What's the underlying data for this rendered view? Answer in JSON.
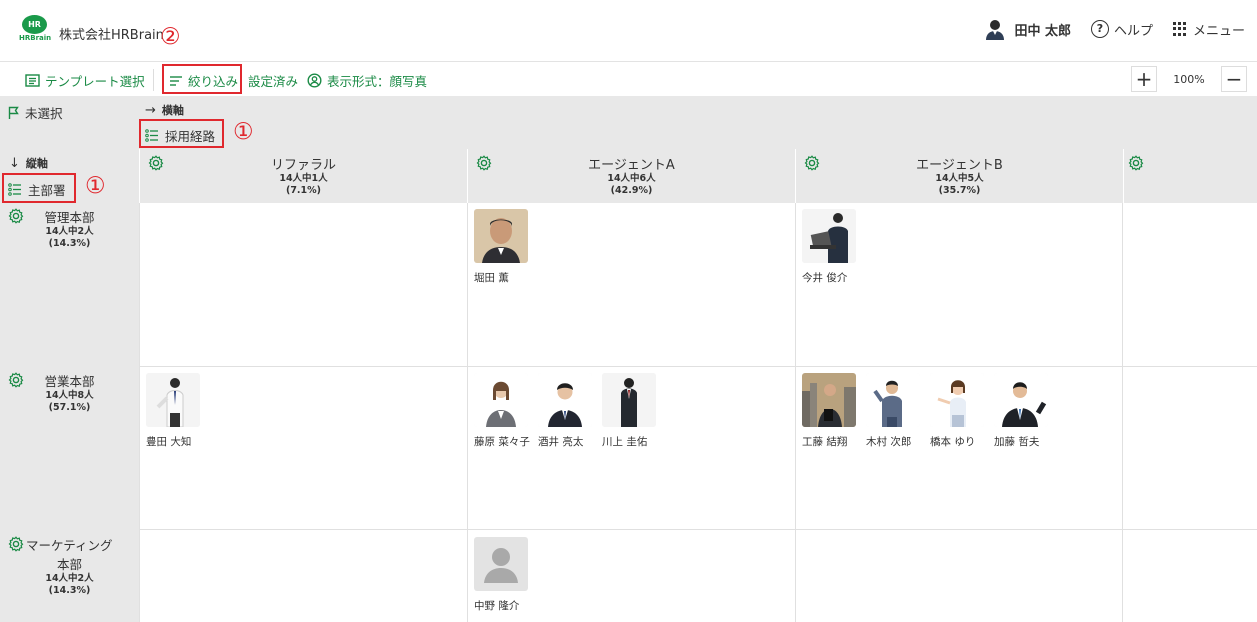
{
  "header": {
    "logo_text": "HR",
    "logo_sub": "HRBrain",
    "company": "株式会社HRBrain",
    "user_name": "田中 太郎",
    "help_label": "ヘルプ",
    "menu_label": "メニュー"
  },
  "toolbar": {
    "template_label": "テンプレート選択",
    "filter_label": "絞り込み",
    "filter_status": "設定済み",
    "display_label": "表示形式：顔写真",
    "zoom": "100%"
  },
  "annotations": {
    "one_a": "①",
    "one_b": "①",
    "two": "②"
  },
  "axes": {
    "unselected": "未選択",
    "horizontal_label": "横軸",
    "horizontal_value": "採用経路",
    "vertical_label": "縦軸",
    "vertical_value": "主部署"
  },
  "columns": [
    {
      "title": "リファラル",
      "count": "14人中1人",
      "pct": "(7.1%)"
    },
    {
      "title": "エージェントA",
      "count": "14人中6人",
      "pct": "(42.9%)"
    },
    {
      "title": "エージェントB",
      "count": "14人中5人",
      "pct": "(35.7%)"
    }
  ],
  "rows": [
    {
      "title": "管理本部",
      "count": "14人中2人",
      "pct": "(14.3%)"
    },
    {
      "title": "営業本部",
      "count": "14人中8人",
      "pct": "(57.1%)"
    },
    {
      "title": "マーケティング",
      "title2": "本部",
      "count": "14人中2人",
      "pct": "(14.3%)"
    }
  ],
  "people": {
    "hotta": "堀田 薫",
    "imai": "今井 俊介",
    "toyota": "豊田 大知",
    "fujiwara": "藤原 菜々子",
    "sakai": "酒井 亮太",
    "kawakami": "川上 圭佑",
    "kudo": "工藤 結翔",
    "kimura": "木村 次郎",
    "hashimoto": "橋本 ゆり",
    "kato": "加藤 哲夫",
    "nakano": "中野 隆介"
  },
  "colors": {
    "accent": "#1a8a45",
    "annotation": "#e0282e",
    "panel": "#e8e8e8"
  }
}
